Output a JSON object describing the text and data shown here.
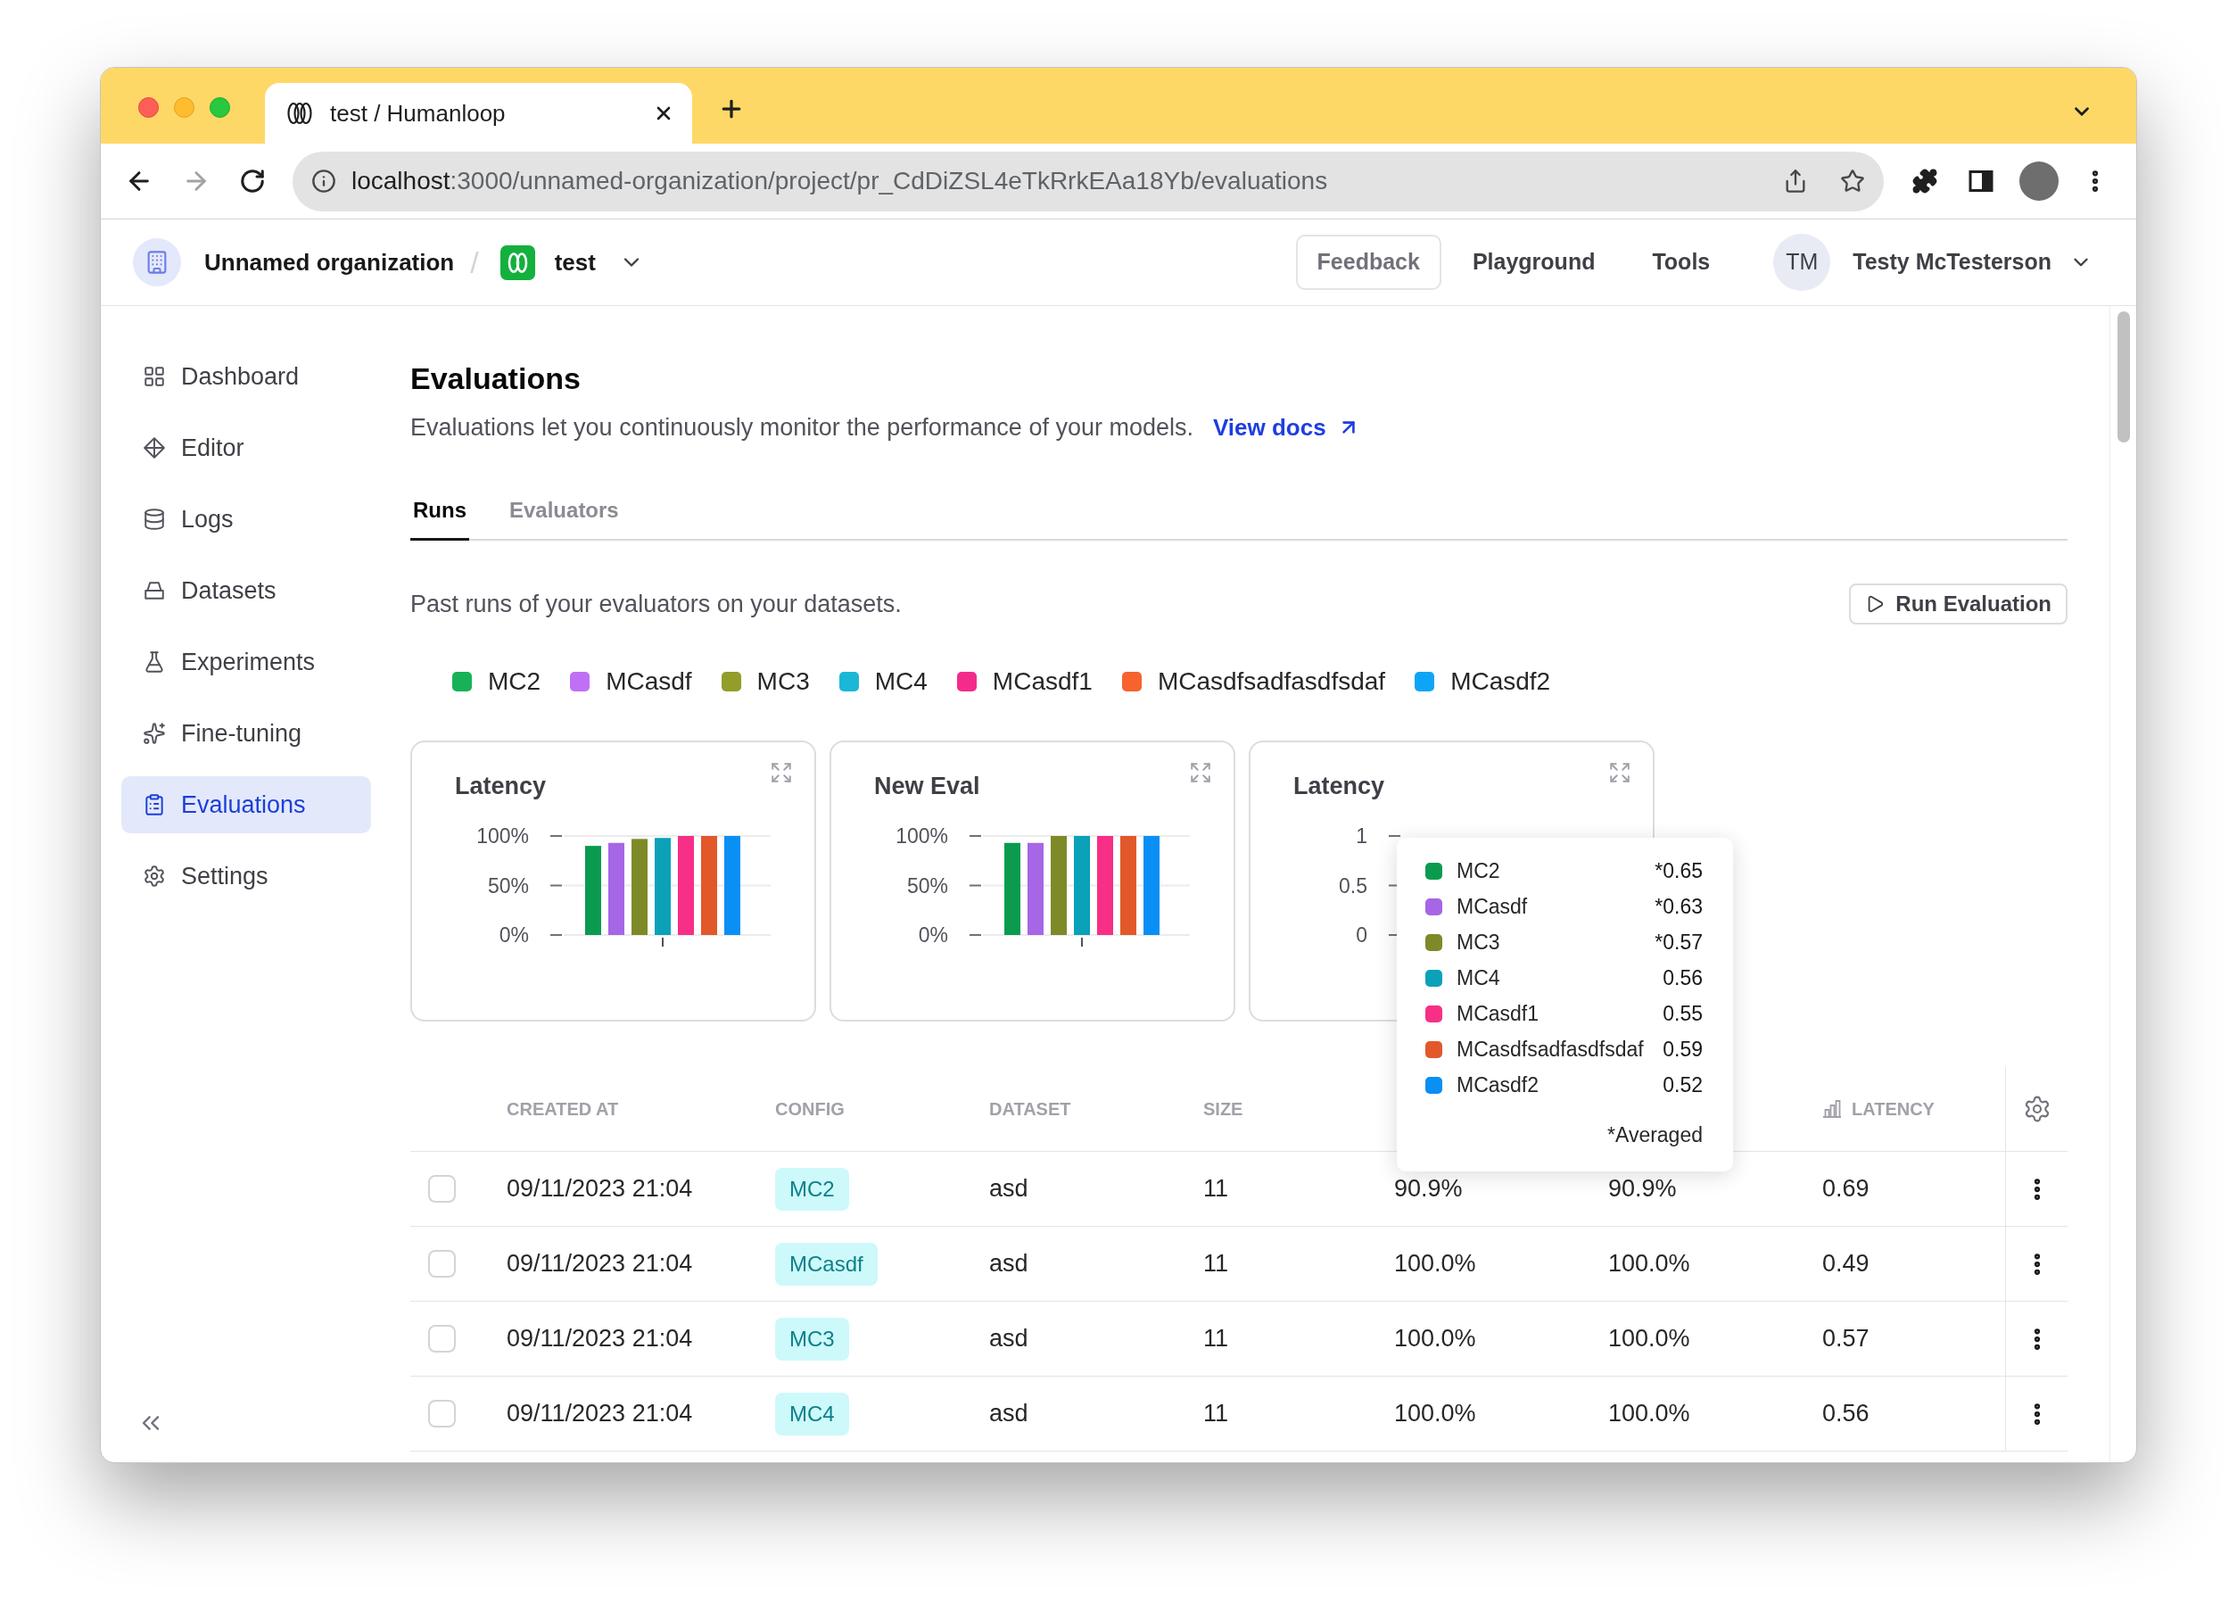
{
  "browser": {
    "tab_title": "test / Humanloop",
    "forward_disabled": true,
    "url": {
      "host": "localhost",
      "path": ":3000/unnamed-organization/project/pr_CdDiZSL4eTkRrkEAa18Yb/evaluations"
    }
  },
  "header": {
    "organization": "Unnamed organization",
    "separator": "/",
    "project": "test",
    "nav": [
      {
        "label": "Feedback",
        "kind": "outlined"
      },
      {
        "label": "Playground",
        "kind": "plain"
      },
      {
        "label": "Tools",
        "kind": "plain"
      }
    ],
    "user": {
      "initials": "TM",
      "name": "Testy McTesterson"
    }
  },
  "sidebar": {
    "items": [
      {
        "label": "Dashboard",
        "selected": false
      },
      {
        "label": "Editor",
        "selected": false
      },
      {
        "label": "Logs",
        "selected": false
      },
      {
        "label": "Datasets",
        "selected": false
      },
      {
        "label": "Experiments",
        "selected": false
      },
      {
        "label": "Fine-tuning",
        "selected": false
      },
      {
        "label": "Evaluations",
        "selected": true
      },
      {
        "label": "Settings",
        "selected": false
      }
    ]
  },
  "page": {
    "title": "Evaluations",
    "description": "Evaluations let you continuously monitor the performance of your models.",
    "docs_link": "View docs"
  },
  "tabs": [
    {
      "label": "Runs",
      "selected": true
    },
    {
      "label": "Evaluators",
      "selected": false
    }
  ],
  "runs": {
    "caption": "Past runs of your evaluators on your datasets.",
    "run_button": "Run Evaluation"
  },
  "legend": [
    {
      "label": "MC2",
      "color": "#17b257"
    },
    {
      "label": "MCasdf",
      "color": "#c070f5"
    },
    {
      "label": "MC3",
      "color": "#929d2a"
    },
    {
      "label": "MC4",
      "color": "#1ab7d7"
    },
    {
      "label": "MCasdf1",
      "color": "#f52b8b"
    },
    {
      "label": "MCasdfsadfasdfsdaf",
      "color": "#f7632f"
    },
    {
      "label": "MCasdf2",
      "color": "#0ea5f6"
    }
  ],
  "charts": [
    {
      "chart_data": {
        "type": "bar",
        "title": "Latency",
        "ylim": [
          0,
          100
        ],
        "yticks": [
          {
            "value": 0,
            "label": "0%"
          },
          {
            "value": 50,
            "label": "50%"
          },
          {
            "value": 100,
            "label": "100%"
          }
        ],
        "series": [
          {
            "color": "#0a9b4f",
            "values": [
              90
            ]
          },
          {
            "color": "#a666e6",
            "values": [
              93
            ]
          },
          {
            "color": "#7e8a27",
            "values": [
              97
            ]
          },
          {
            "color": "#0aa1b9",
            "values": [
              98
            ]
          },
          {
            "color": "#f72f87",
            "values": [
              100
            ]
          },
          {
            "color": "#e2582b",
            "values": [
              100
            ]
          },
          {
            "color": "#0a8ff5",
            "values": [
              100
            ]
          }
        ]
      }
    },
    {
      "chart_data": {
        "type": "bar",
        "title": "New Eval",
        "ylim": [
          0,
          100
        ],
        "yticks": [
          {
            "value": 0,
            "label": "0%"
          },
          {
            "value": 50,
            "label": "50%"
          },
          {
            "value": 100,
            "label": "100%"
          }
        ],
        "series": [
          {
            "color": "#0a9b4f",
            "values": [
              93
            ]
          },
          {
            "color": "#a666e6",
            "values": [
              93
            ]
          },
          {
            "color": "#7e8a27",
            "values": [
              100
            ]
          },
          {
            "color": "#0aa1b9",
            "values": [
              100
            ]
          },
          {
            "color": "#f72f87",
            "values": [
              100
            ]
          },
          {
            "color": "#e2582b",
            "values": [
              100
            ]
          },
          {
            "color": "#0a8ff5",
            "values": [
              100
            ]
          }
        ]
      }
    },
    {
      "title": "Latency",
      "y_tick_labels": [
        "1",
        "0.5",
        "0"
      ]
    }
  ],
  "tooltip": {
    "items": [
      {
        "label": "MC2",
        "value": "*0.65",
        "color": "#0a9b4f"
      },
      {
        "label": "MCasdf",
        "value": "*0.63",
        "color": "#a666e6"
      },
      {
        "label": "MC3",
        "value": "*0.57",
        "color": "#7e8a27"
      },
      {
        "label": "MC4",
        "value": "0.56",
        "color": "#0aa1b9"
      },
      {
        "label": "MCasdf1",
        "value": "0.55",
        "color": "#f72f87"
      },
      {
        "label": "MCasdfsadfasdfsdaf",
        "value": "0.59",
        "color": "#e2582b"
      },
      {
        "label": "MCasdf2",
        "value": "0.52",
        "color": "#0a8ff5"
      }
    ],
    "note": "*Averaged"
  },
  "table": {
    "columns": {
      "created_at": "CREATED AT",
      "config": "CONFIG",
      "dataset": "DATASET",
      "size": "SIZE",
      "latency": "LATENCY"
    },
    "rows": [
      {
        "checked": false,
        "created_at": "09/11/2023 21:04",
        "config": "MC2",
        "dataset": "asd",
        "size": "11",
        "column_5": "90.9%",
        "column_6": "90.9%",
        "latency": "0.69"
      },
      {
        "checked": false,
        "created_at": "09/11/2023 21:04",
        "config": "MCasdf",
        "dataset": "asd",
        "size": "11",
        "column_5": "100.0%",
        "column_6": "100.0%",
        "latency": "0.49"
      },
      {
        "checked": false,
        "created_at": "09/11/2023 21:04",
        "config": "MC3",
        "dataset": "asd",
        "size": "11",
        "column_5": "100.0%",
        "column_6": "100.0%",
        "latency": "0.57"
      },
      {
        "checked": false,
        "created_at": "09/11/2023 21:04",
        "config": "MC4",
        "dataset": "asd",
        "size": "11",
        "column_5": "100.0%",
        "column_6": "100.0%",
        "latency": "0.56"
      }
    ]
  }
}
